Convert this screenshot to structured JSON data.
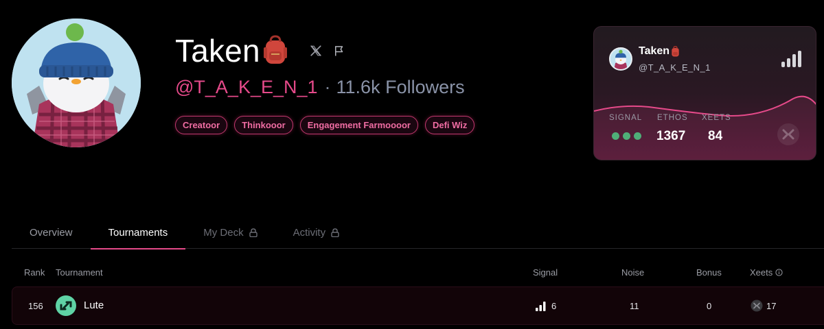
{
  "profile": {
    "name": "Taken",
    "handle": "@T_A_K_E_N_1",
    "separator": "·",
    "followers": "11.6k Followers",
    "tags": [
      "Creatoor",
      "Thinkooor",
      "Engagement Farmoooor",
      "Defi Wiz"
    ]
  },
  "card": {
    "name": "Taken",
    "handle": "@T_A_K_E_N_1",
    "signal_label": "SIGNAL",
    "ethos_label": "ETHOS",
    "ethos_value": "1367",
    "xeets_label": "XEETS",
    "xeets_value": "84",
    "signal_level_dots": 3
  },
  "tabs": [
    {
      "label": "Overview",
      "active": false,
      "locked": false
    },
    {
      "label": "Tournaments",
      "active": true,
      "locked": false
    },
    {
      "label": "My Deck",
      "active": false,
      "locked": true
    },
    {
      "label": "Activity",
      "active": false,
      "locked": true
    }
  ],
  "table": {
    "columns": {
      "rank": "Rank",
      "tournament": "Tournament",
      "signal": "Signal",
      "noise": "Noise",
      "bonus": "Bonus",
      "xeets": "Xeets"
    },
    "rows": [
      {
        "rank": "156",
        "tournament": "Lute",
        "signal": "6",
        "noise": "11",
        "bonus": "0",
        "xeets": "17"
      }
    ]
  },
  "colors": {
    "accent_pink": "#e64a8a",
    "signal_green": "#4fae78",
    "lute_green": "#5fd3a5"
  },
  "icons": [
    "penguin-avatar",
    "backpack-icon",
    "x-icon",
    "flag-icon",
    "signal-bars-icon",
    "lock-icon",
    "info-icon",
    "lute-logo-icon",
    "xeet-logo-icon"
  ]
}
